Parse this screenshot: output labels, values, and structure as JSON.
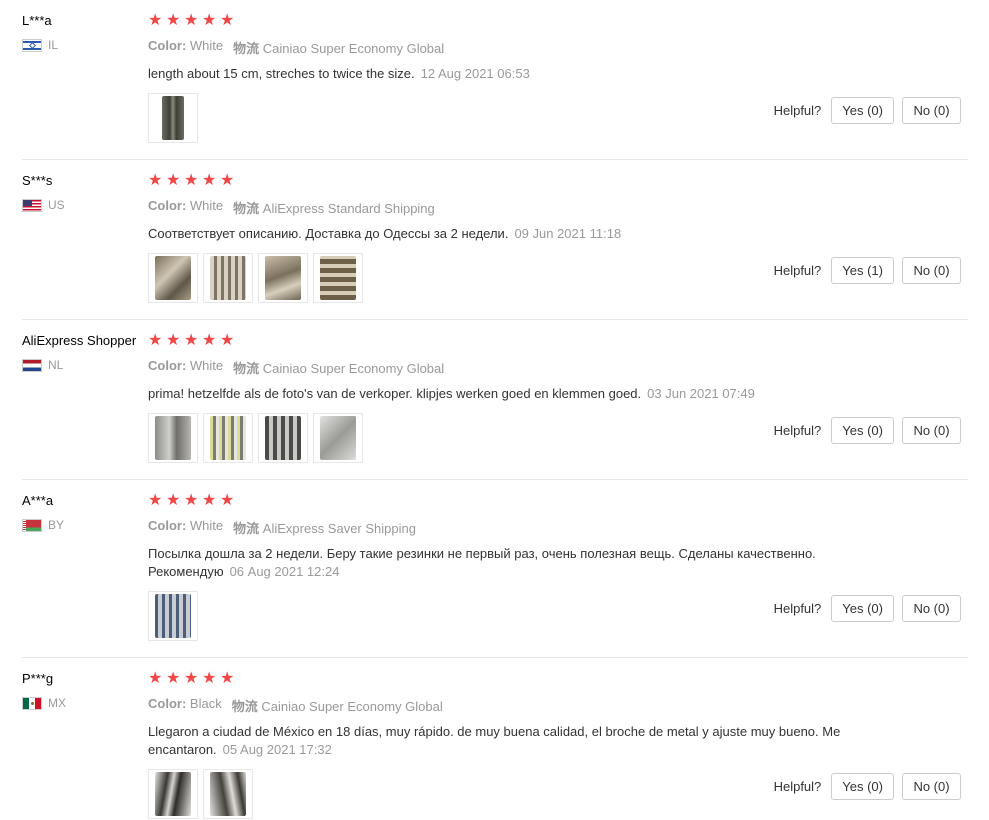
{
  "helpful_label": "Helpful?",
  "reviews": [
    {
      "user": "L***a",
      "country": "IL",
      "stars": 5,
      "color_label": "Color:",
      "color": "White",
      "shipping_label": "物流",
      "shipping": "Cainiao Super Economy Global",
      "text": "length about 15 cm, streches to twice the size.",
      "date": "12 Aug 2021 06:53",
      "photos": 1,
      "yes": "Yes (0)",
      "no": "No (0)"
    },
    {
      "user": "S***s",
      "country": "US",
      "stars": 5,
      "color_label": "Color:",
      "color": "White",
      "shipping_label": "物流",
      "shipping": "AliExpress Standard Shipping",
      "text": "Соответствует описанию. Доставка до Одессы за 2 недели.",
      "date": "09 Jun 2021 11:18",
      "photos": 4,
      "yes": "Yes (1)",
      "no": "No (0)"
    },
    {
      "user": "AliExpress Shopper",
      "country": "NL",
      "stars": 5,
      "color_label": "Color:",
      "color": "White",
      "shipping_label": "物流",
      "shipping": "Cainiao Super Economy Global",
      "text": "prima! hetzelfde als de foto's van de verkoper. klipjes werken goed en klemmen goed.",
      "date": "03 Jun 2021 07:49",
      "photos": 4,
      "yes": "Yes (0)",
      "no": "No (0)"
    },
    {
      "user": "A***a",
      "country": "BY",
      "stars": 5,
      "color_label": "Color:",
      "color": "White",
      "shipping_label": "物流",
      "shipping": "AliExpress Saver Shipping",
      "text": "Посылка дошла за 2 недели. Беру такие резинки не первый раз, очень полезная вещь. Сделаны качественно. Рекомендую",
      "date": "06 Aug 2021 12:24",
      "photos": 1,
      "yes": "Yes (0)",
      "no": "No (0)"
    },
    {
      "user": "P***g",
      "country": "MX",
      "stars": 5,
      "color_label": "Color:",
      "color": "Black",
      "shipping_label": "物流",
      "shipping": "Cainiao Super Economy Global",
      "text": "Llegaron a ciudad de México en 18 días, muy rápido. de muy buena calidad, el broche de metal y ajuste muy bueno. Me encantaron.",
      "date": "05 Aug 2021 17:32",
      "photos": 2,
      "yes": "Yes (0)",
      "no": "No (0)"
    }
  ]
}
